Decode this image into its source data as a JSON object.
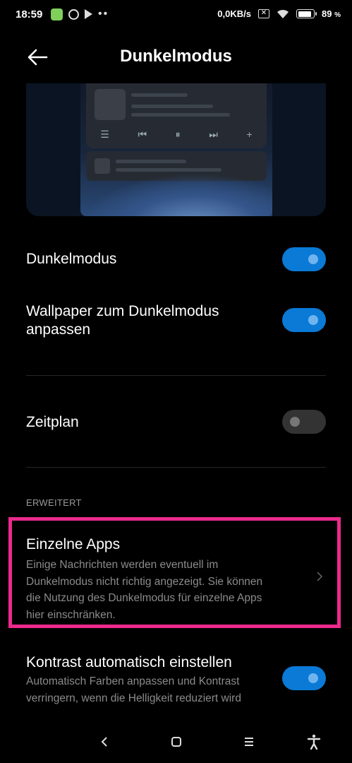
{
  "status_bar": {
    "time": "18:59",
    "network_speed": "0,0KB/s",
    "battery_percent": "89",
    "battery_unit": "%",
    "icons": [
      "app-icon",
      "circle-icon",
      "play-store-icon",
      "more-dots-icon",
      "no-sim-icon",
      "wifi-icon",
      "battery-icon"
    ]
  },
  "header": {
    "title": "Dunkelmodus",
    "back_icon": "arrow-left-icon"
  },
  "settings": {
    "dark_mode": {
      "label": "Dunkelmodus",
      "enabled": true
    },
    "wallpaper": {
      "label_line1": "Wallpaper zum Dunkelmodus",
      "label_line2": "anpassen",
      "enabled": true
    },
    "schedule": {
      "label": "Zeitplan",
      "enabled": false
    }
  },
  "advanced": {
    "section_title": "ERWEITERT",
    "individual_apps": {
      "title": "Einzelne Apps",
      "desc_line1": "Einige Nachrichten werden eventuell im",
      "desc_line2": "Dunkelmodus nicht richtig angezeigt. Sie können",
      "desc_line3": "die Nutzung des Dunkelmodus für einzelne Apps",
      "desc_line4": "hier einschränken."
    },
    "auto_contrast": {
      "title": "Kontrast automatisch einstellen",
      "desc_line1": "Automatisch Farben anpassen und Kontrast",
      "desc_line2": "verringern, wenn die Helligkeit reduziert wird",
      "enabled": true
    }
  },
  "colors": {
    "accent": "#0a7ad6",
    "highlight": "#ec2a8c",
    "background": "#000000"
  }
}
